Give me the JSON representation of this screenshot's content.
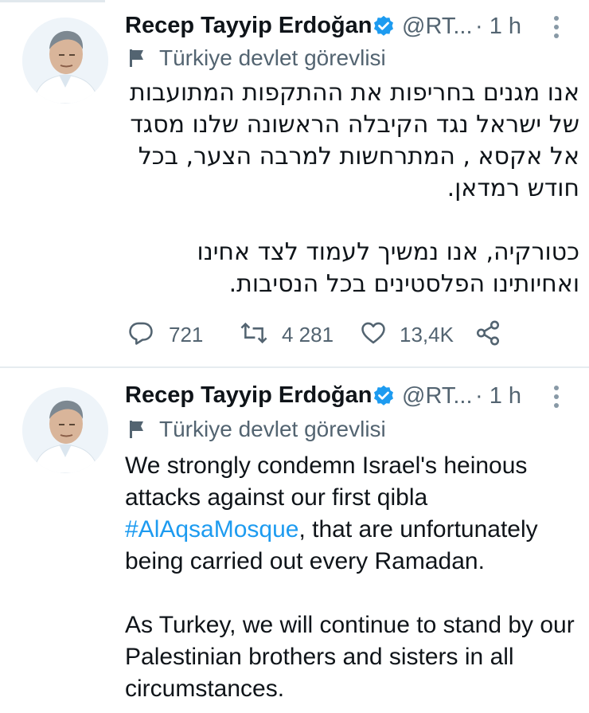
{
  "tweets": [
    {
      "author_name": "Recep Tayyip Erdoğan",
      "handle": "@RT...",
      "time": "· 1 h",
      "label": "Türkiye devlet görevlisi",
      "text_paragraph_1": "אנו מגנים בחריפות את ההתקפות המתועבות של ישראל נגד הקיבלה הראשונה שלנו מסגד אל אקסא , המתרחשות למרבה הצער,  בכל חודש רמדאן.",
      "text_paragraph_2": "כטורקיה, אנו נמשיך לעמוד לצד אחינו ואחיותינו הפלסטינים בכל הנסיבות.",
      "replies": "721",
      "retweets": "4 281",
      "likes": "13,4K"
    },
    {
      "author_name": "Recep Tayyip Erdoğan",
      "handle": "@RT...",
      "time": "· 1 h",
      "label": "Türkiye devlet görevlisi",
      "text_part_1": "We strongly condemn Israel's heinous attacks against our first qibla ",
      "hashtag": "#AlAqsaMosque",
      "text_part_2": ", that are unfortunately being carried out every Ramadan.",
      "text_paragraph_2": "As Turkey, we will continue to stand by our Palestinian brothers and sisters in all circumstances."
    }
  ],
  "icons": {
    "verified": "verified-badge-icon",
    "label": "flag-icon",
    "menu": "more-vertical-icon",
    "reply": "reply-icon",
    "retweet": "retweet-icon",
    "like": "heart-icon",
    "share": "share-icon"
  },
  "colors": {
    "verified": "#1d9bf0",
    "hashtag": "#1d9bf0",
    "secondary_text": "#536471"
  }
}
